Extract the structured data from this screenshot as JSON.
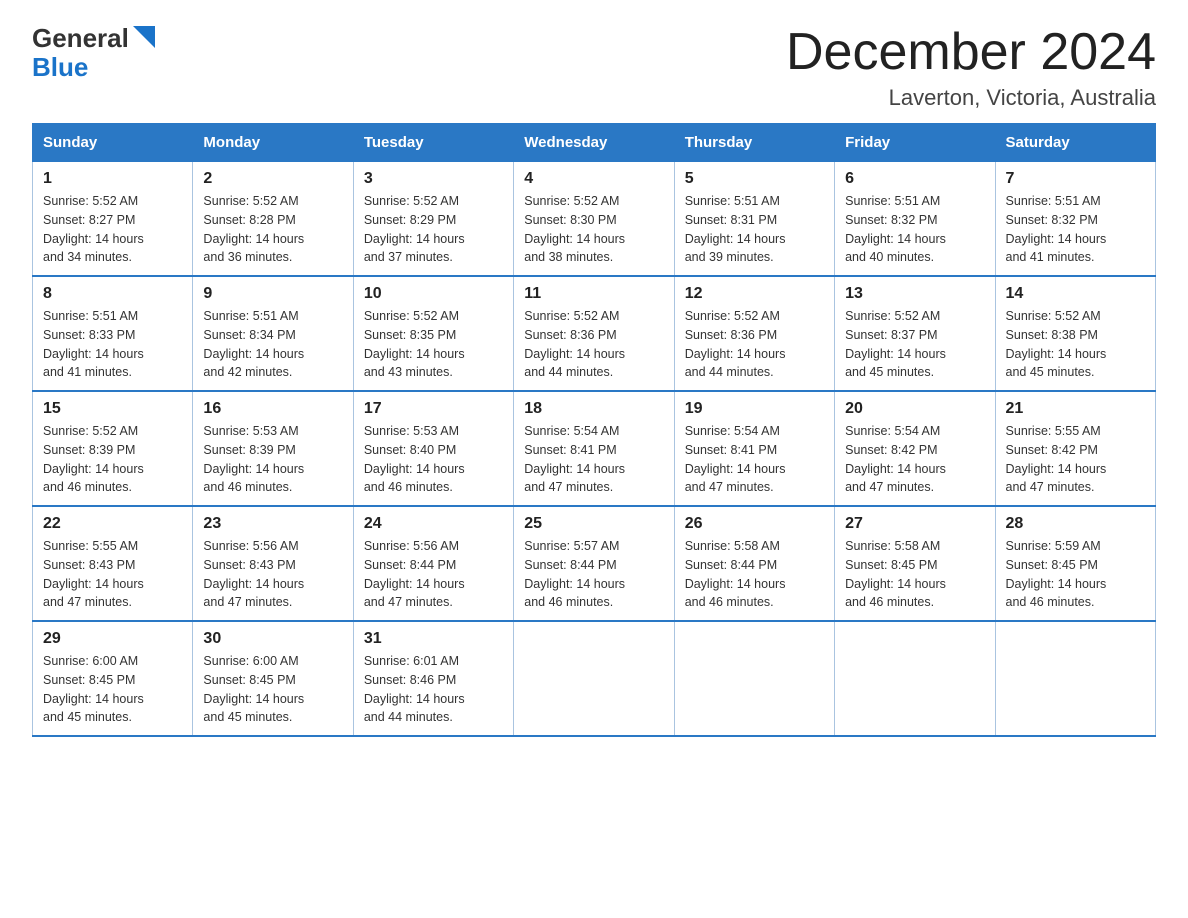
{
  "logo": {
    "text_general": "General",
    "text_blue": "Blue"
  },
  "title": "December 2024",
  "location": "Laverton, Victoria, Australia",
  "days_of_week": [
    "Sunday",
    "Monday",
    "Tuesday",
    "Wednesday",
    "Thursday",
    "Friday",
    "Saturday"
  ],
  "weeks": [
    [
      {
        "day": "1",
        "sunrise": "5:52 AM",
        "sunset": "8:27 PM",
        "daylight": "14 hours and 34 minutes."
      },
      {
        "day": "2",
        "sunrise": "5:52 AM",
        "sunset": "8:28 PM",
        "daylight": "14 hours and 36 minutes."
      },
      {
        "day": "3",
        "sunrise": "5:52 AM",
        "sunset": "8:29 PM",
        "daylight": "14 hours and 37 minutes."
      },
      {
        "day": "4",
        "sunrise": "5:52 AM",
        "sunset": "8:30 PM",
        "daylight": "14 hours and 38 minutes."
      },
      {
        "day": "5",
        "sunrise": "5:51 AM",
        "sunset": "8:31 PM",
        "daylight": "14 hours and 39 minutes."
      },
      {
        "day": "6",
        "sunrise": "5:51 AM",
        "sunset": "8:32 PM",
        "daylight": "14 hours and 40 minutes."
      },
      {
        "day": "7",
        "sunrise": "5:51 AM",
        "sunset": "8:32 PM",
        "daylight": "14 hours and 41 minutes."
      }
    ],
    [
      {
        "day": "8",
        "sunrise": "5:51 AM",
        "sunset": "8:33 PM",
        "daylight": "14 hours and 41 minutes."
      },
      {
        "day": "9",
        "sunrise": "5:51 AM",
        "sunset": "8:34 PM",
        "daylight": "14 hours and 42 minutes."
      },
      {
        "day": "10",
        "sunrise": "5:52 AM",
        "sunset": "8:35 PM",
        "daylight": "14 hours and 43 minutes."
      },
      {
        "day": "11",
        "sunrise": "5:52 AM",
        "sunset": "8:36 PM",
        "daylight": "14 hours and 44 minutes."
      },
      {
        "day": "12",
        "sunrise": "5:52 AM",
        "sunset": "8:36 PM",
        "daylight": "14 hours and 44 minutes."
      },
      {
        "day": "13",
        "sunrise": "5:52 AM",
        "sunset": "8:37 PM",
        "daylight": "14 hours and 45 minutes."
      },
      {
        "day": "14",
        "sunrise": "5:52 AM",
        "sunset": "8:38 PM",
        "daylight": "14 hours and 45 minutes."
      }
    ],
    [
      {
        "day": "15",
        "sunrise": "5:52 AM",
        "sunset": "8:39 PM",
        "daylight": "14 hours and 46 minutes."
      },
      {
        "day": "16",
        "sunrise": "5:53 AM",
        "sunset": "8:39 PM",
        "daylight": "14 hours and 46 minutes."
      },
      {
        "day": "17",
        "sunrise": "5:53 AM",
        "sunset": "8:40 PM",
        "daylight": "14 hours and 46 minutes."
      },
      {
        "day": "18",
        "sunrise": "5:54 AM",
        "sunset": "8:41 PM",
        "daylight": "14 hours and 47 minutes."
      },
      {
        "day": "19",
        "sunrise": "5:54 AM",
        "sunset": "8:41 PM",
        "daylight": "14 hours and 47 minutes."
      },
      {
        "day": "20",
        "sunrise": "5:54 AM",
        "sunset": "8:42 PM",
        "daylight": "14 hours and 47 minutes."
      },
      {
        "day": "21",
        "sunrise": "5:55 AM",
        "sunset": "8:42 PM",
        "daylight": "14 hours and 47 minutes."
      }
    ],
    [
      {
        "day": "22",
        "sunrise": "5:55 AM",
        "sunset": "8:43 PM",
        "daylight": "14 hours and 47 minutes."
      },
      {
        "day": "23",
        "sunrise": "5:56 AM",
        "sunset": "8:43 PM",
        "daylight": "14 hours and 47 minutes."
      },
      {
        "day": "24",
        "sunrise": "5:56 AM",
        "sunset": "8:44 PM",
        "daylight": "14 hours and 47 minutes."
      },
      {
        "day": "25",
        "sunrise": "5:57 AM",
        "sunset": "8:44 PM",
        "daylight": "14 hours and 46 minutes."
      },
      {
        "day": "26",
        "sunrise": "5:58 AM",
        "sunset": "8:44 PM",
        "daylight": "14 hours and 46 minutes."
      },
      {
        "day": "27",
        "sunrise": "5:58 AM",
        "sunset": "8:45 PM",
        "daylight": "14 hours and 46 minutes."
      },
      {
        "day": "28",
        "sunrise": "5:59 AM",
        "sunset": "8:45 PM",
        "daylight": "14 hours and 46 minutes."
      }
    ],
    [
      {
        "day": "29",
        "sunrise": "6:00 AM",
        "sunset": "8:45 PM",
        "daylight": "14 hours and 45 minutes."
      },
      {
        "day": "30",
        "sunrise": "6:00 AM",
        "sunset": "8:45 PM",
        "daylight": "14 hours and 45 minutes."
      },
      {
        "day": "31",
        "sunrise": "6:01 AM",
        "sunset": "8:46 PM",
        "daylight": "14 hours and 44 minutes."
      },
      null,
      null,
      null,
      null
    ]
  ],
  "labels": {
    "sunrise": "Sunrise:",
    "sunset": "Sunset:",
    "daylight": "Daylight:"
  }
}
